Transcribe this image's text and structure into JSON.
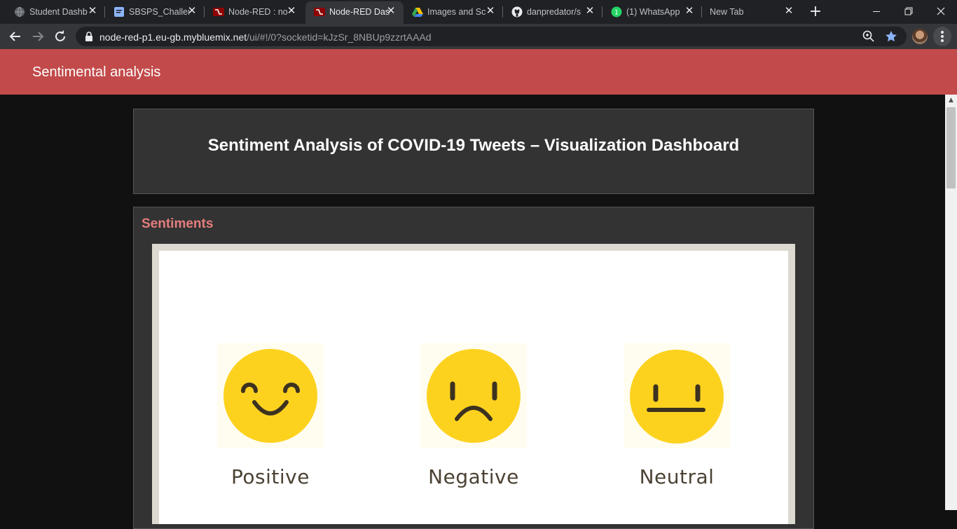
{
  "browser": {
    "tabs": [
      {
        "title": "Student Dashb",
        "icon": "globe-icon"
      },
      {
        "title": "SBSPS_Challen",
        "icon": "doc-icon"
      },
      {
        "title": "Node-RED : no",
        "icon": "node-red-icon"
      },
      {
        "title": "Node-RED Das",
        "icon": "node-red-icon",
        "active": true
      },
      {
        "title": "Images and Sc",
        "icon": "google-drive-icon"
      },
      {
        "title": "danpredator/s",
        "icon": "github-icon"
      },
      {
        "title": "(1) WhatsApp",
        "icon": "whatsapp-icon"
      },
      {
        "title": "New Tab",
        "icon": ""
      }
    ],
    "close_glyph": "✕",
    "new_tab_glyph": "+",
    "url_host": "node-red-p1.eu-gb.mybluemix.net",
    "url_path": "/ui/#!/0?socketid=kJzSr_8NBUp9zzrtAAAd"
  },
  "dashboard": {
    "app_title": "Sentimental analysis",
    "accent_color": "#c24a4a",
    "main_title": "Sentiment Analysis of COVID-19 Tweets – Visualization Dashboard",
    "group_label": "Sentiments",
    "sentiments": [
      {
        "label": "Positive",
        "icon": "smiling-face-icon"
      },
      {
        "label": "Negative",
        "icon": "frowning-face-icon"
      },
      {
        "label": "Neutral",
        "icon": "neutral-face-icon"
      }
    ]
  }
}
